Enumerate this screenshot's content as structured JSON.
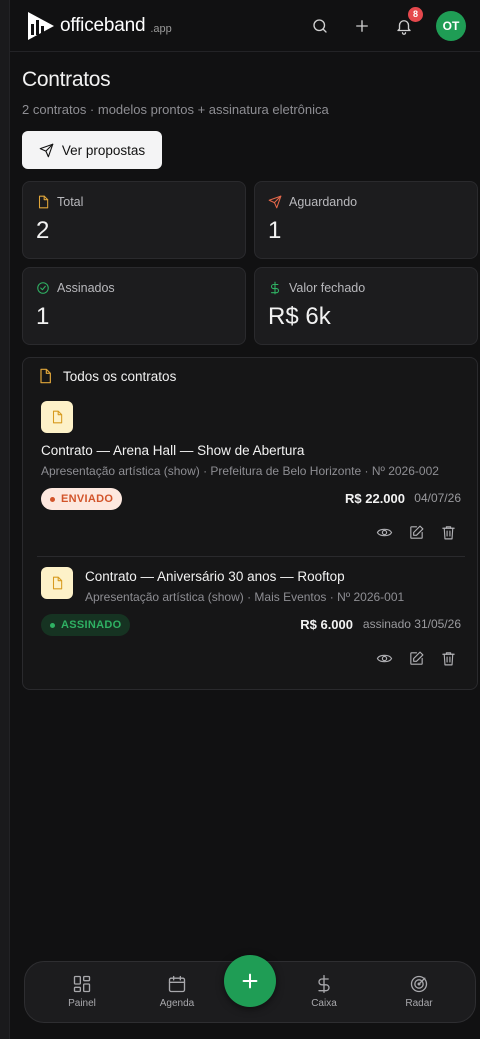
{
  "header": {
    "logo_text": "officeband",
    "logo_suffix": ".app",
    "notifications_count": "8",
    "avatar_initials": "OT"
  },
  "page": {
    "title": "Contratos",
    "subtitle": "2 contratos · modelos prontos + assinatura eletrônica",
    "proposals_button": "Ver propostas"
  },
  "stats": [
    {
      "label": "Total",
      "value": "2",
      "icon": "file-icon",
      "color": "#e0a53a"
    },
    {
      "label": "Aguardando",
      "value": "1",
      "icon": "send-icon",
      "color": "#e5684a"
    },
    {
      "label": "Assinados",
      "value": "1",
      "icon": "check-circle-icon",
      "color": "#2fb163"
    },
    {
      "label": "Valor fechado",
      "value": "R$ 6k",
      "icon": "dollar-icon",
      "color": "#2fb163"
    }
  ],
  "contracts_panel": {
    "title": "Todos os contratos",
    "items": [
      {
        "title": "Contrato — Arena Hall — Show de Abertura",
        "meta": "Apresentação artística (show) · Prefeitura de Belo Horizonte · Nº 2026-002",
        "status": "ENVIADO",
        "amount": "R$ 22.000",
        "date": "04/07/26"
      },
      {
        "title": "Contrato — Aniversário 30 anos — Rooftop",
        "meta": "Apresentação artística (show) · Mais Eventos · Nº 2026-001",
        "status": "ASSINADO",
        "amount": "R$ 6.000",
        "date": "assinado 31/05/26"
      }
    ]
  },
  "bottom_nav": {
    "items": [
      {
        "label": "Painel",
        "icon": "grid-icon"
      },
      {
        "label": "Agenda",
        "icon": "calendar-icon"
      },
      {
        "label": "Caixa",
        "icon": "dollar-icon"
      },
      {
        "label": "Radar",
        "icon": "radar-icon"
      }
    ]
  },
  "colors": {
    "brand_green": "#1f9d55",
    "accent_amber": "#e0a53a",
    "badge_red": "#e5484d"
  }
}
